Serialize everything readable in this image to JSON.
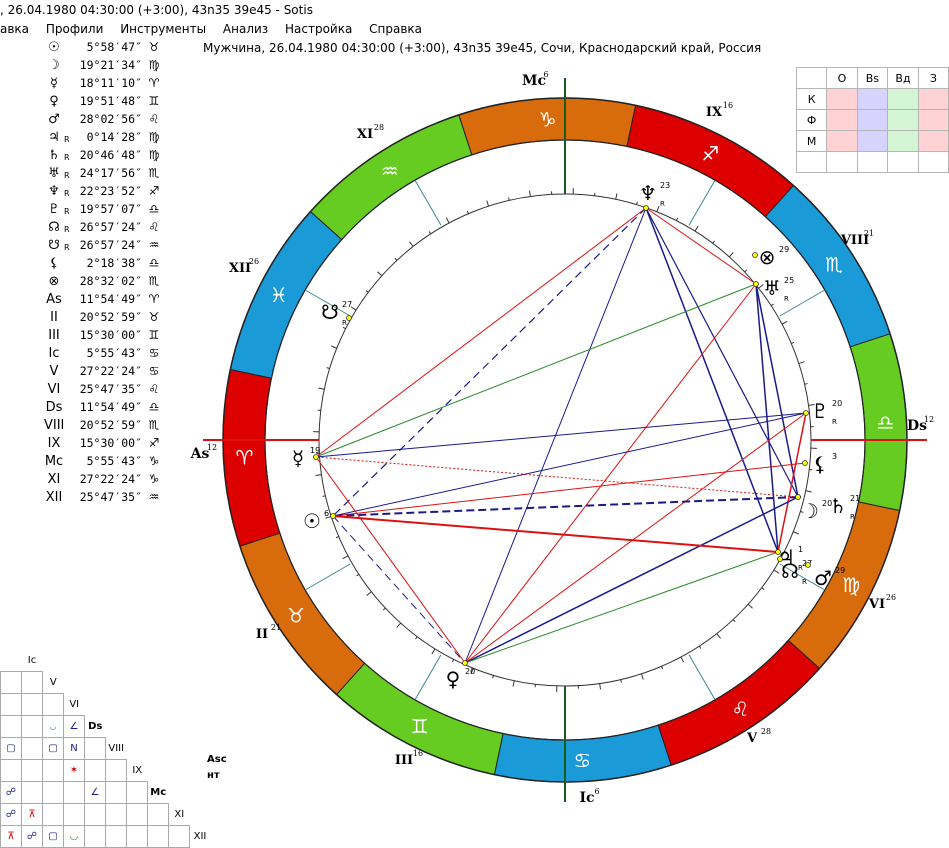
{
  "window": {
    "title": ", 26.04.1980 04:30:00 (+3:00), 43n35 39e45 - Sotis"
  },
  "menu": [
    "авка",
    "Профили",
    "Инструменты",
    "Анализ",
    "Настройка",
    "Справка"
  ],
  "chart_title": "Мужчина, 26.04.1980 04:30:00 (+3:00), 43n35 39e45, Сочи, Краснодарский край, Россия",
  "planets": [
    {
      "sym": "☉",
      "r": "",
      "deg": "5°58′47″",
      "sign": "♉"
    },
    {
      "sym": "☽",
      "r": "",
      "deg": "19°21′34″",
      "sign": "♍"
    },
    {
      "sym": "☿",
      "r": "",
      "deg": "18°11′10″",
      "sign": "♈"
    },
    {
      "sym": "♀",
      "r": "",
      "deg": "19°51′48″",
      "sign": "♊"
    },
    {
      "sym": "♂",
      "r": "",
      "deg": "28°02′56″",
      "sign": "♌"
    },
    {
      "sym": "♃",
      "r": "R",
      "deg": "0°14′28″",
      "sign": "♍"
    },
    {
      "sym": "♄",
      "r": "R",
      "deg": "20°46′48″",
      "sign": "♍"
    },
    {
      "sym": "♅",
      "r": "R",
      "deg": "24°17′56″",
      "sign": "♏"
    },
    {
      "sym": "♆",
      "r": "R",
      "deg": "22°23′52″",
      "sign": "♐"
    },
    {
      "sym": "♇",
      "r": "R",
      "deg": "19°57′07″",
      "sign": "♎"
    },
    {
      "sym": "☊",
      "r": "R",
      "deg": "26°57′24″",
      "sign": "♌"
    },
    {
      "sym": "☋",
      "r": "R",
      "deg": "26°57′24″",
      "sign": "♒"
    },
    {
      "sym": "⚸",
      "r": "",
      "deg": "2°18′38″",
      "sign": "♎"
    },
    {
      "sym": "⊗",
      "r": "",
      "deg": "28°32′02″",
      "sign": "♏"
    },
    {
      "sym": "As",
      "r": "",
      "deg": "11°54′49″",
      "sign": "♈"
    },
    {
      "sym": "II",
      "r": "",
      "deg": "20°52′59″",
      "sign": "♉"
    },
    {
      "sym": "III",
      "r": "",
      "deg": "15°30′00″",
      "sign": "♊"
    },
    {
      "sym": "Ic",
      "r": "",
      "deg": "5°55′43″",
      "sign": "♋"
    },
    {
      "sym": "V",
      "r": "",
      "deg": "27°22′24″",
      "sign": "♋"
    },
    {
      "sym": "VI",
      "r": "",
      "deg": "25°47′35″",
      "sign": "♌"
    },
    {
      "sym": "Ds",
      "r": "",
      "deg": "11°54′49″",
      "sign": "♎"
    },
    {
      "sym": "VIII",
      "r": "",
      "deg": "20°52′59″",
      "sign": "♏"
    },
    {
      "sym": "IX",
      "r": "",
      "deg": "15°30′00″",
      "sign": "♐"
    },
    {
      "sym": "Mc",
      "r": "",
      "deg": "5°55′43″",
      "sign": "♑"
    },
    {
      "sym": "XI",
      "r": "",
      "deg": "27°22′24″",
      "sign": "♑"
    },
    {
      "sym": "XII",
      "r": "",
      "deg": "25°47′35″",
      "sign": "♒"
    }
  ],
  "wheel": {
    "signs": [
      "♈",
      "♉",
      "♊",
      "♋",
      "♌",
      "♍",
      "♎",
      "♏",
      "♐",
      "♑",
      "♒",
      "♓"
    ],
    "sign_colors": [
      "#dd0000",
      "#d86b0c",
      "#66cc22",
      "#1a9ad6",
      "#dd0000",
      "#d86b0c",
      "#66cc22",
      "#1a9ad6",
      "#dd0000",
      "#d86b0c",
      "#66cc22",
      "#1a9ad6"
    ],
    "axis_labels": {
      "as": "As",
      "as_deg": "12",
      "ds": "Ds",
      "ds_deg": "12",
      "mc": "Mc",
      "mc_deg": "6",
      "ic": "Ic",
      "ic_deg": "6"
    },
    "houses": [
      {
        "label": "II",
        "deg": "21"
      },
      {
        "label": "III",
        "deg": "16"
      },
      {
        "label": "V",
        "deg": "28"
      },
      {
        "label": "VI",
        "deg": "26"
      },
      {
        "label": "VIII",
        "deg": "21"
      },
      {
        "label": "IX",
        "deg": "16"
      },
      {
        "label": "XI",
        "deg": "28"
      },
      {
        "label": "XII",
        "deg": "26"
      }
    ],
    "planet_labels": [
      {
        "sym": "♆",
        "deg": "23",
        "r": "R"
      },
      {
        "sym": "♅",
        "deg": "25",
        "r": "R"
      },
      {
        "sym": "⊗",
        "deg": "29",
        "r": ""
      },
      {
        "sym": "♇",
        "deg": "20",
        "r": "R"
      },
      {
        "sym": "⚸",
        "deg": "3",
        "r": ""
      },
      {
        "sym": "♄",
        "deg": "21",
        "r": "R"
      },
      {
        "sym": "☽",
        "deg": "20",
        "r": ""
      },
      {
        "sym": "♃",
        "deg": "1",
        "r": "R"
      },
      {
        "sym": "☊",
        "deg": "27",
        "r": "R"
      },
      {
        "sym": "♂",
        "deg": "29",
        "r": ""
      },
      {
        "sym": "♀",
        "deg": "20",
        "r": ""
      },
      {
        "sym": "☉",
        "deg": "6",
        "r": ""
      },
      {
        "sym": "☿",
        "deg": "19",
        "r": ""
      },
      {
        "sym": "☋",
        "deg": "27",
        "r": "R"
      }
    ]
  },
  "aspect_table": {
    "headers": [
      "",
      "O",
      "Bs",
      "Вд",
      "З"
    ],
    "rows": [
      "К",
      "Ф",
      "М"
    ]
  },
  "grid_labels": [
    "Ic",
    "V",
    "VI",
    "Ds",
    "VIII",
    "IX",
    "Mc",
    "XI",
    "XII"
  ],
  "asc_label": "Asc",
  "nt_label": "нт"
}
